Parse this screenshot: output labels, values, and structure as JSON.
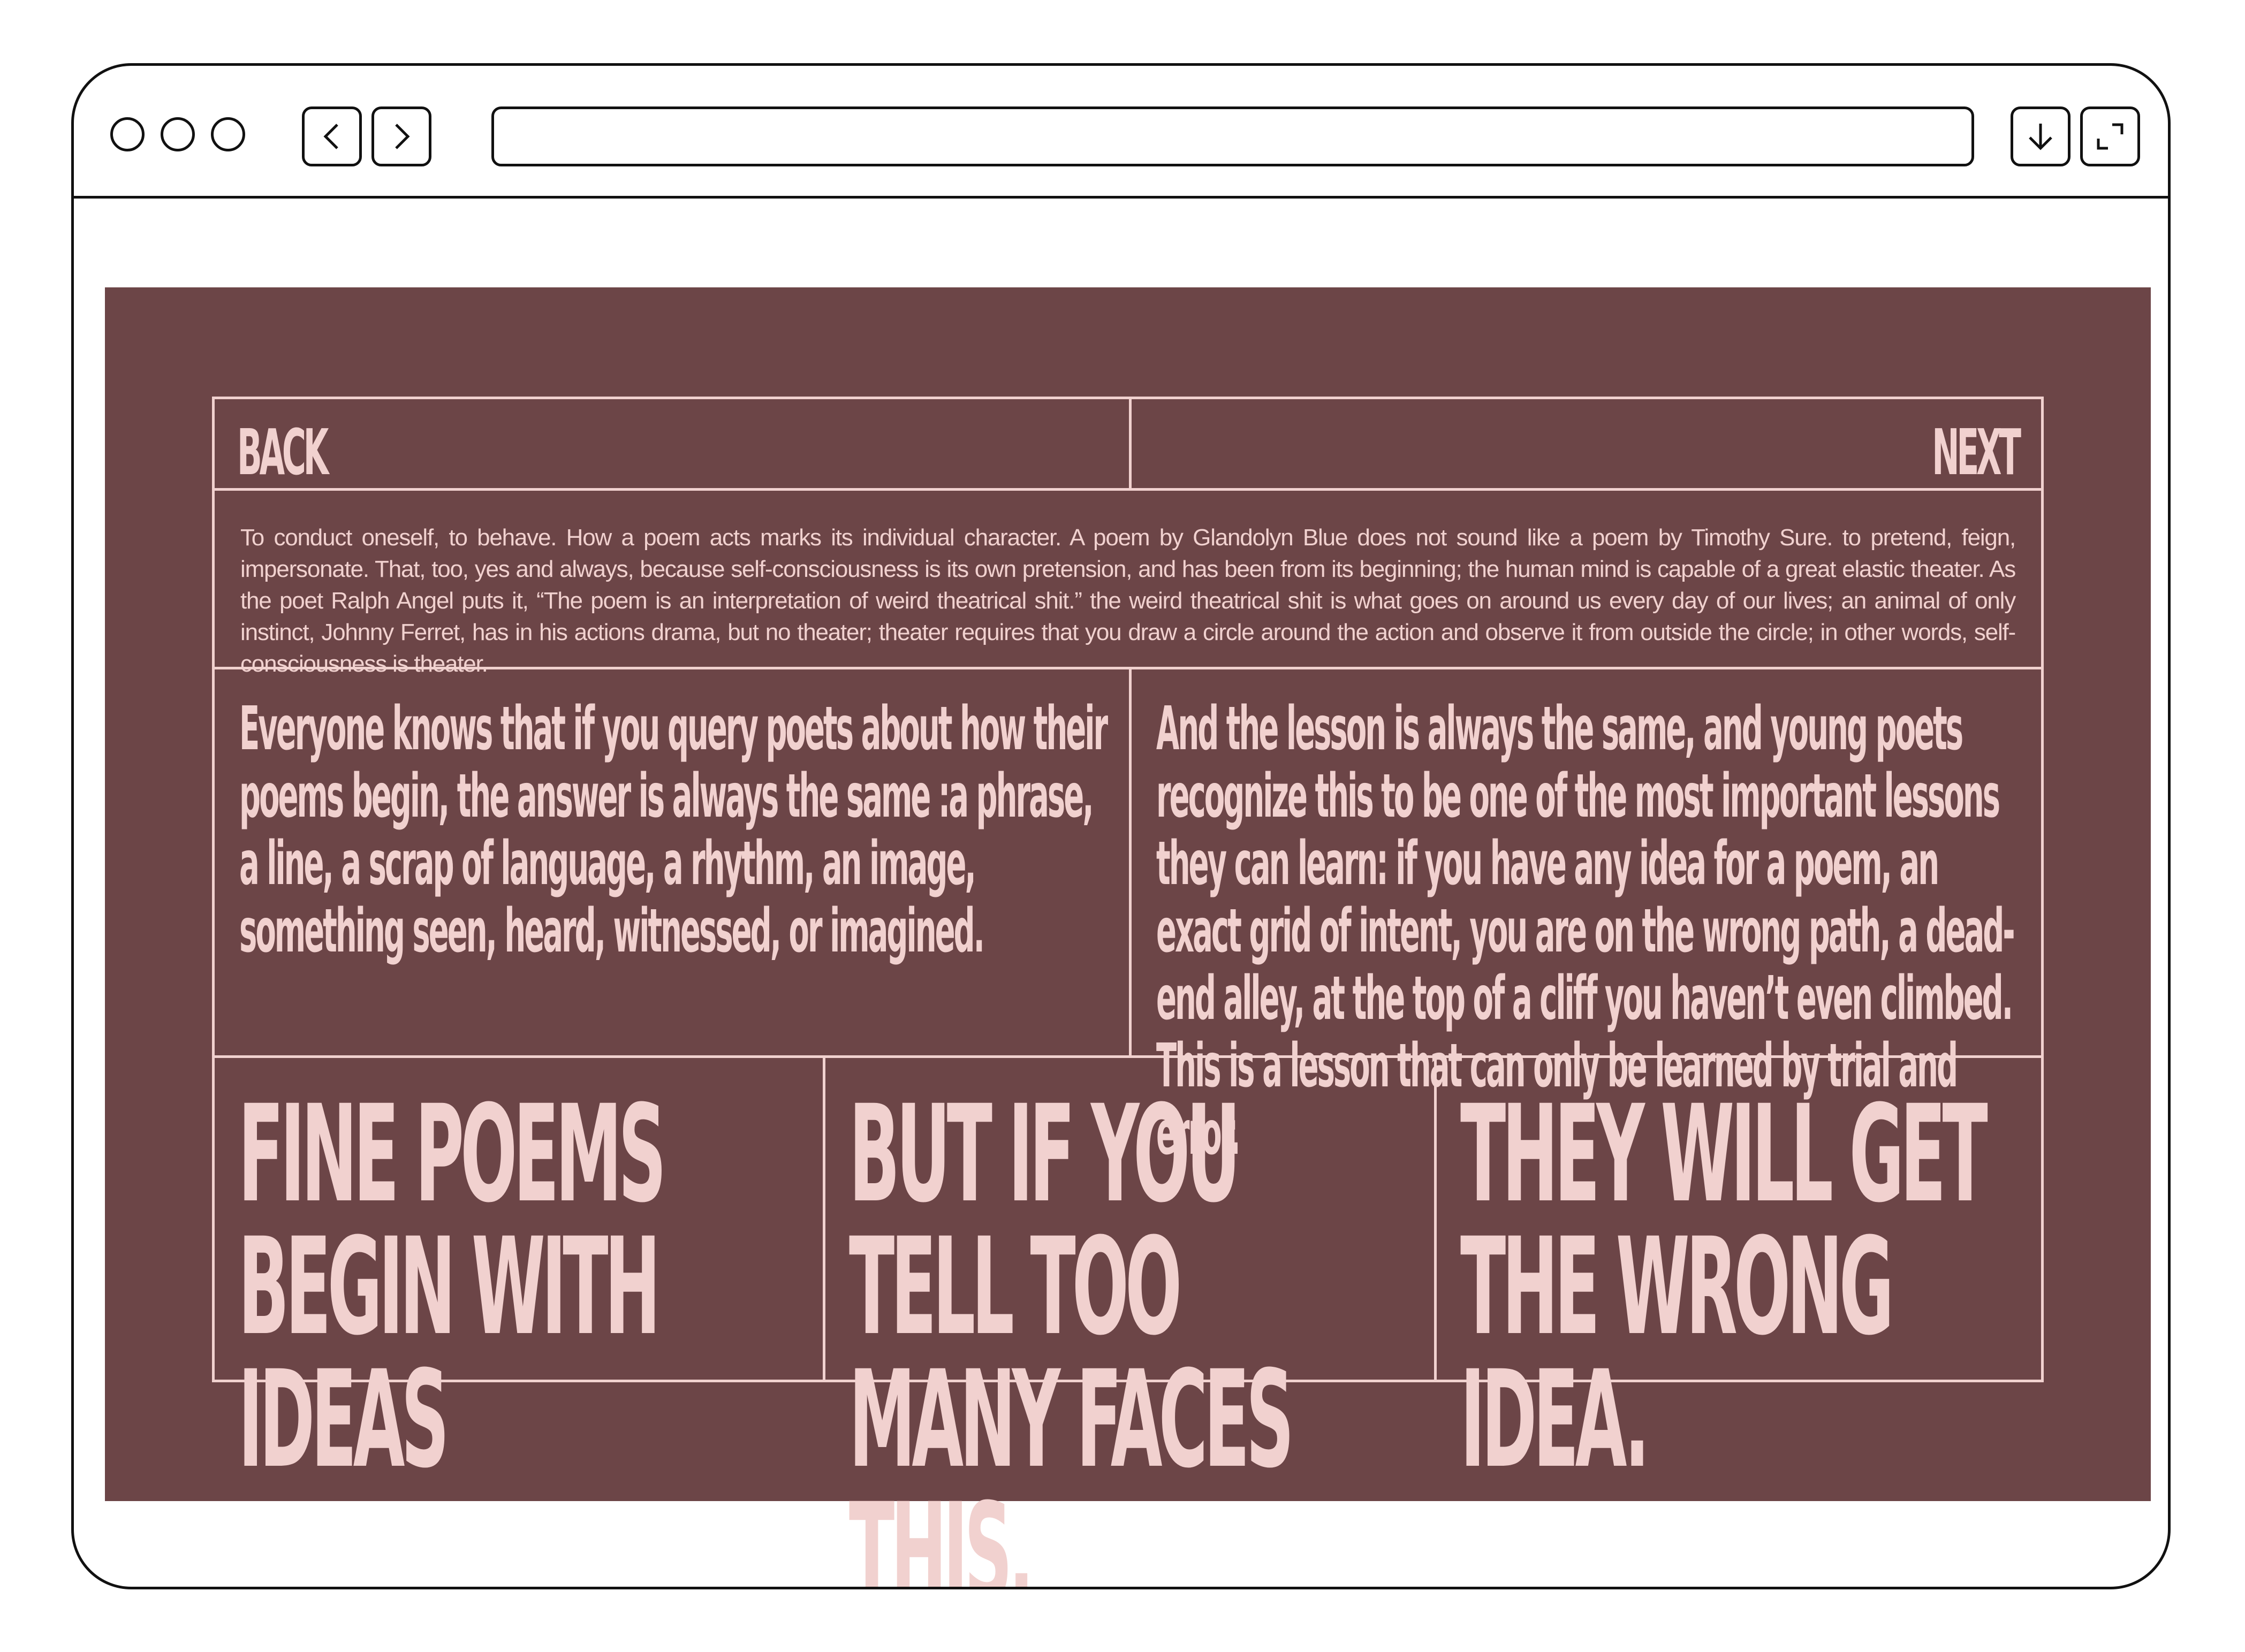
{
  "browser": {
    "window_controls": [
      "close",
      "minimize",
      "maximize"
    ],
    "nav_icons": [
      "chevron-left-icon",
      "chevron-right-icon"
    ],
    "action_icons": [
      "download-icon",
      "expand-icon"
    ],
    "url": ""
  },
  "colors": {
    "poster_background": "#6c4547",
    "poster_text": "#f1d1cf",
    "frame": "#111111"
  },
  "nav": {
    "back": "BACK",
    "next": "NEXT"
  },
  "intro": "To conduct oneself, to behave. How a poem acts marks its individual character. A poem by Glandolyn Blue does not sound like a poem by Timothy Sure. to pretend, feign, impersonate. That, too, yes and always, because self-consciousness is its own pretension, and has been from its beginning; the human mind is capable of a great elastic theater. As the poet Ralph Angel puts it, “The poem is an interpretation of weird theatrical shit.” the weird theatrical shit is what goes on around us every day of our lives; an animal of only instinct, Johnny Ferret, has in his actions drama, but no theater; theater requires that you draw a circle around the action and observe it from outside the circle; in other words, self-consciousness is theater.",
  "columns": {
    "left": "Everyone knows that if you query poets about how their poems begin, the answer is always the same :a phrase, a line, a scrap of language, a rhythm, an image, something seen, heard, witnessed, or imagined.",
    "right": "And the lesson is always the same, and young poets recognize this to be one of the most important lessons they can learn: if you have any idea for a poem, an exact grid of intent, you are on the wrong path, a dead-end alley, at the top of a cliff you haven’t even climbed. This is a lesson that can only be learned by trial and error."
  },
  "headlines": [
    "FINE POEMS BEGIN WITH IDEAS",
    "BUT IF YOU TELL TOO MANY FACES THIS,",
    "THEY WILL GET THE WRONG IDEA."
  ]
}
